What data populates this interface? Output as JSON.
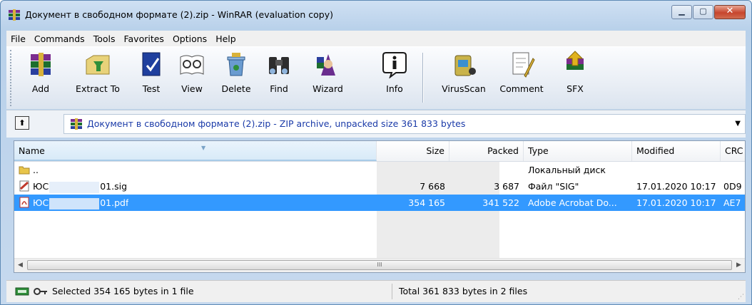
{
  "window": {
    "title": "Документ в свободном формате (2).zip - WinRAR (evaluation copy)",
    "minimize_glyph": "▁",
    "maximize_glyph": "▢",
    "close_glyph": "✕"
  },
  "menu": [
    "File",
    "Commands",
    "Tools",
    "Favorites",
    "Options",
    "Help"
  ],
  "toolbar": {
    "buttons": [
      {
        "label": "Add",
        "icon": "add-archive-icon"
      },
      {
        "label": "Extract To",
        "icon": "extract-icon"
      },
      {
        "label": "Test",
        "icon": "test-icon"
      },
      {
        "label": "View",
        "icon": "view-icon"
      },
      {
        "label": "Delete",
        "icon": "delete-icon"
      },
      {
        "label": "Find",
        "icon": "find-binoculars-icon"
      },
      {
        "label": "Wizard",
        "icon": "wizard-icon"
      },
      {
        "label": "Info",
        "icon": "info-icon"
      },
      {
        "label": "VirusScan",
        "icon": "virusscan-icon"
      },
      {
        "label": "Comment",
        "icon": "comment-icon"
      },
      {
        "label": "SFX",
        "icon": "sfx-icon"
      }
    ]
  },
  "address": {
    "up_glyph": "⬆",
    "text": "Документ в свободном формате (2).zip - ZIP archive, unpacked size 361 833 bytes",
    "dropdown_glyph": "▼"
  },
  "list": {
    "columns": [
      "Name",
      "Size",
      "Packed",
      "Type",
      "Modified",
      "CRC"
    ],
    "rows": [
      {
        "name": "..",
        "name_tail": "",
        "size": "",
        "packed": "",
        "type": "Локальный диск",
        "modified": "",
        "crc": "",
        "icon": "folder-up-icon",
        "selected": false
      },
      {
        "name": "ЮС",
        "name_tail": "01.sig",
        "size": "7 668",
        "packed": "3 687",
        "type": "Файл \"SIG\"",
        "modified": "17.01.2020 10:17",
        "crc": "0D9",
        "icon": "sig-file-icon",
        "selected": false
      },
      {
        "name": "ЮС",
        "name_tail": "01.pdf",
        "size": "354 165",
        "packed": "341 522",
        "type": "Adobe Acrobat Do...",
        "modified": "17.01.2020 10:17",
        "crc": "AE7",
        "icon": "pdf-file-icon",
        "selected": true
      }
    ],
    "scroll_left_glyph": "◀",
    "scroll_right_glyph": "▶",
    "thumb_grip": "III"
  },
  "status": {
    "left": "Selected 354 165 bytes in 1 file",
    "right": "Total 361 833 bytes in 2 files",
    "icons": [
      "drive-icon",
      "key-icon"
    ]
  }
}
